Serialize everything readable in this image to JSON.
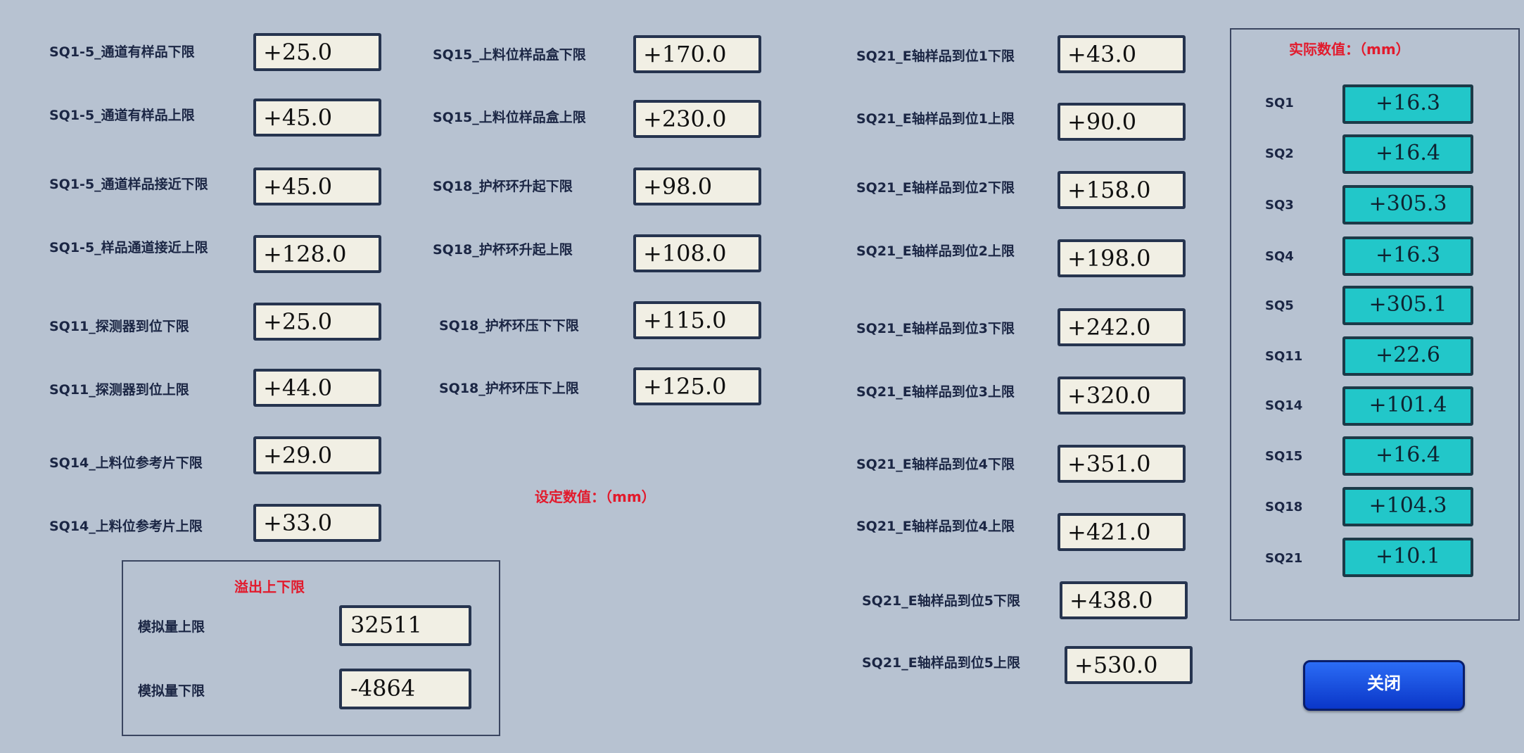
{
  "section_set_title": "设定数值：（mm）",
  "section_actual_title": "实际数值：（mm）",
  "overflow_title": "溢出上下限",
  "col1": [
    {
      "label": "SQ1-5_通道有样品下限",
      "value": "+25.0"
    },
    {
      "label": "SQ1-5_通道有样品上限",
      "value": "+45.0"
    },
    {
      "label": "SQ1-5_通道样品接近下限",
      "value": "+45.0"
    },
    {
      "label": "SQ1-5_样品通道接近上限",
      "value": "+128.0"
    },
    {
      "label": "SQ11_探测器到位下限",
      "value": "+25.0"
    },
    {
      "label": "SQ11_探测器到位上限",
      "value": "+44.0"
    },
    {
      "label": "SQ14_上料位参考片下限",
      "value": "+29.0"
    },
    {
      "label": "SQ14_上料位参考片上限",
      "value": "+33.0"
    }
  ],
  "col2": [
    {
      "label": "SQ15_上料位样品盒下限",
      "value": "+170.0"
    },
    {
      "label": "SQ15_上料位样品盒上限",
      "value": "+230.0"
    },
    {
      "label": "SQ18_护杯环升起下限",
      "value": "+98.0"
    },
    {
      "label": "SQ18_护杯环升起上限",
      "value": "+108.0"
    },
    {
      "label": "SQ18_护杯环压下下限",
      "value": "+115.0"
    },
    {
      "label": "SQ18_护杯环压下上限",
      "value": "+125.0"
    }
  ],
  "col3": [
    {
      "label": "SQ21_E轴样品到位1下限",
      "value": "+43.0"
    },
    {
      "label": "SQ21_E轴样品到位1上限",
      "value": "+90.0"
    },
    {
      "label": "SQ21_E轴样品到位2下限",
      "value": "+158.0"
    },
    {
      "label": "SQ21_E轴样品到位2上限",
      "value": "+198.0"
    },
    {
      "label": "SQ21_E轴样品到位3下限",
      "value": "+242.0"
    },
    {
      "label": "SQ21_E轴样品到位3上限",
      "value": "+320.0"
    },
    {
      "label": "SQ21_E轴样品到位4下限",
      "value": "+351.0"
    },
    {
      "label": "SQ21_E轴样品到位4上限",
      "value": "+421.0"
    },
    {
      "label": "SQ21_E轴样品到位5下限",
      "value": "+438.0"
    },
    {
      "label": "SQ21_E轴样品到位5上限",
      "value": "+530.0"
    }
  ],
  "overflow": [
    {
      "label": "模拟量上限",
      "value": "32511"
    },
    {
      "label": "模拟量下限",
      "value": "-4864"
    }
  ],
  "actual": [
    {
      "label": "SQ1",
      "value": "+16.3"
    },
    {
      "label": "SQ2",
      "value": "+16.4"
    },
    {
      "label": "SQ3",
      "value": "+305.3"
    },
    {
      "label": "SQ4",
      "value": "+16.3"
    },
    {
      "label": "SQ5",
      "value": "+305.1"
    },
    {
      "label": "SQ11",
      "value": "+22.6"
    },
    {
      "label": "SQ14",
      "value": "+101.4"
    },
    {
      "label": "SQ15",
      "value": "+16.4"
    },
    {
      "label": "SQ18",
      "value": "+104.3"
    },
    {
      "label": "SQ21",
      "value": "+10.1"
    }
  ],
  "close_label": "关闭",
  "colors": {
    "background": "#b7c2d1",
    "field": "#f1efe4",
    "actual_field": "#22c7c9",
    "title_red": "#e21a2c",
    "button": "#0a36c8"
  }
}
